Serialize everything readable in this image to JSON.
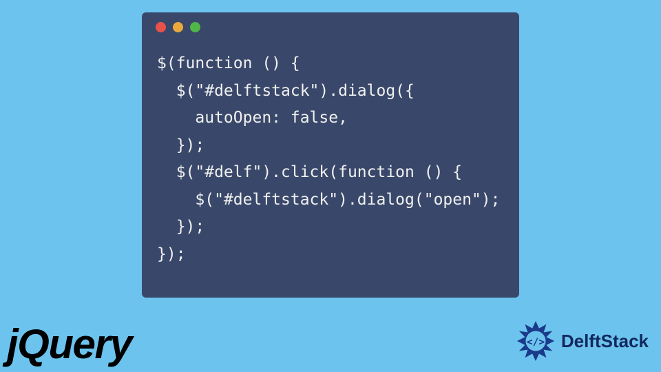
{
  "window": {
    "dots": {
      "red": "#e9524a",
      "yellow": "#e9a93c",
      "green": "#4fb748"
    }
  },
  "code": {
    "l1": "$(function () {",
    "l2": "  $(\"#delftstack\").dialog({",
    "l3": "    autoOpen: false,",
    "l4": "  });",
    "l5": "  $(\"#delf\").click(function () {",
    "l6": "    $(\"#delftstack\").dialog(\"open\");",
    "l7": "  });",
    "l8": "});"
  },
  "logos": {
    "jquery": "jQuery",
    "delftstack": "DelftStack"
  }
}
